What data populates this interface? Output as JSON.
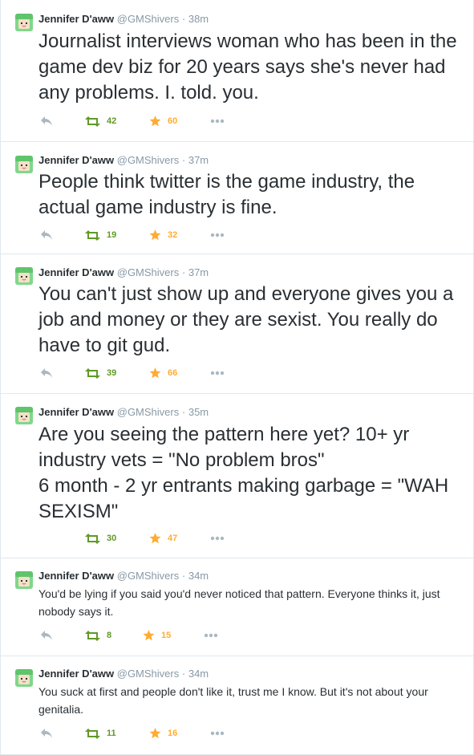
{
  "tweets": [
    {
      "name": "Jennifer D'aww",
      "handle": "@GMShivers",
      "separator": "·",
      "time": "38m",
      "text": "Journalist interviews woman who has been in the game dev biz for 20 years says she's never had any problems. I. told. you.",
      "retweets": "42",
      "favorites": "60",
      "size": "big"
    },
    {
      "name": "Jennifer D'aww",
      "handle": "@GMShivers",
      "separator": "·",
      "time": "37m",
      "text": "People think twitter is the game industry, the actual game industry is fine.",
      "retweets": "19",
      "favorites": "32",
      "size": "big"
    },
    {
      "name": "Jennifer D'aww",
      "handle": "@GMShivers",
      "separator": "·",
      "time": "37m",
      "text": "You can't just show up and everyone gives you a job and money or they are sexist. You really do have to git gud.",
      "retweets": "39",
      "favorites": "66",
      "size": "big"
    },
    {
      "name": "Jennifer D'aww",
      "handle": "@GMShivers",
      "separator": "·",
      "time": "35m",
      "text": "Are you seeing the pattern here yet? 10+ yr industry vets = \"No problem bros\"\n6 month - 2 yr entrants making garbage = \"WAH SEXISM\"",
      "retweets": "30",
      "favorites": "47",
      "size": "big"
    },
    {
      "name": "Jennifer D'aww",
      "handle": "@GMShivers",
      "separator": "·",
      "time": "34m",
      "text": "You'd be lying if you said you'd never noticed that pattern. Everyone thinks it, just nobody says it.",
      "retweets": "8",
      "favorites": "15",
      "size": "small"
    },
    {
      "name": "Jennifer D'aww",
      "handle": "@GMShivers",
      "separator": "·",
      "time": "34m",
      "text": "You suck at first and people don't like it, trust me I know. But it's not about your genitalia.",
      "retweets": "11",
      "favorites": "16",
      "size": "small"
    }
  ],
  "icons": {
    "reply": "reply-icon",
    "retweet": "retweet-icon",
    "favorite": "star-icon",
    "more": "more-options-icon",
    "avatar": "avatar-image"
  },
  "colors": {
    "retweet": "#609928",
    "favorite": "#ffac33",
    "muted": "#8899a6",
    "text": "#292f33",
    "avatar_bg": "#7fd88a",
    "divider": "#e1e8ed"
  }
}
